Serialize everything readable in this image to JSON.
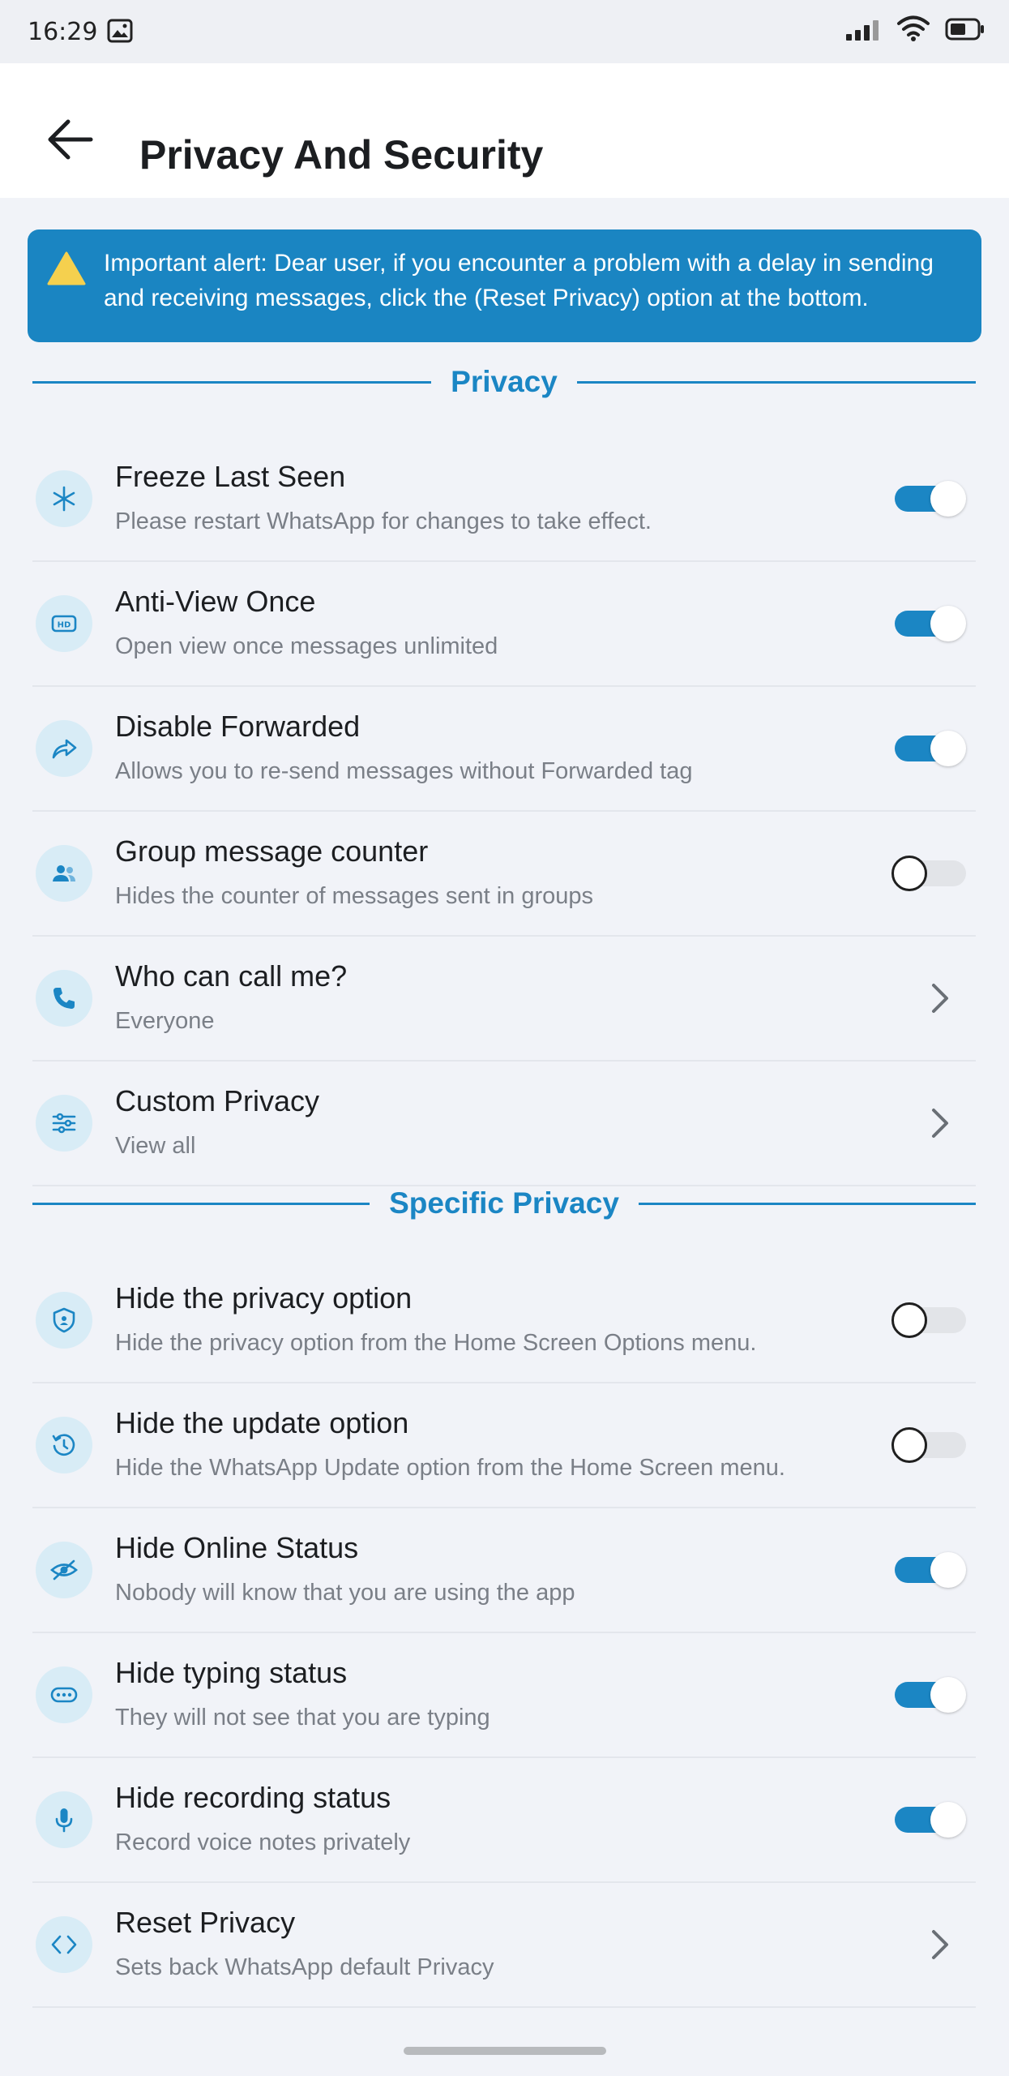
{
  "status_bar": {
    "time": "16:29"
  },
  "header": {
    "title": "Privacy And Security"
  },
  "alert": {
    "text": "Important alert: Dear user, if you encounter a problem with a delay in sending and receiving messages, click the (Reset Privacy) option at the bottom."
  },
  "sections": {
    "privacy": "Privacy",
    "specific_privacy": "Specific Privacy"
  },
  "privacy_items": [
    {
      "title": "Freeze Last Seen",
      "subtitle": "Please restart WhatsApp for changes to take effect.",
      "icon": "snowflake-icon",
      "toggle": true
    },
    {
      "title": "Anti-View Once",
      "subtitle": "Open view once messages unlimited",
      "icon": "hd-icon",
      "toggle": true
    },
    {
      "title": "Disable Forwarded",
      "subtitle": "Allows you to re-send messages without Forwarded tag",
      "icon": "forward-icon",
      "toggle": true
    },
    {
      "title": "Group message counter",
      "subtitle": "Hides the counter of messages sent in groups",
      "icon": "group-icon",
      "toggle": false
    },
    {
      "title": "Who can call me?",
      "subtitle": "Everyone",
      "icon": "phone-icon",
      "chevron": true
    },
    {
      "title": "Custom Privacy",
      "subtitle": "View all",
      "icon": "sliders-icon",
      "chevron": true
    }
  ],
  "specific_items": [
    {
      "title": "Hide the privacy option",
      "subtitle": "Hide the privacy option from the Home Screen Options menu.",
      "icon": "shield-icon",
      "toggle": false
    },
    {
      "title": "Hide the update option",
      "subtitle": "Hide the WhatsApp Update option from the Home Screen menu.",
      "icon": "history-icon",
      "toggle": false
    },
    {
      "title": "Hide Online Status",
      "subtitle": "Nobody will know that you are using the app",
      "icon": "eye-off-icon",
      "toggle": true
    },
    {
      "title": "Hide typing status",
      "subtitle": "They will not see that you are typing",
      "icon": "typing-icon",
      "toggle": true
    },
    {
      "title": "Hide recording status",
      "subtitle": "Record voice notes privately",
      "icon": "microphone-icon",
      "toggle": true
    },
    {
      "title": "Reset Privacy",
      "subtitle": "Sets back WhatsApp default Privacy",
      "icon": "code-icon",
      "chevron": true
    }
  ],
  "colors": {
    "accent": "#1b86c4",
    "alert_bg": "#1a85c2",
    "icon_bg": "#d8ecf6",
    "background": "#f1f3f8"
  }
}
